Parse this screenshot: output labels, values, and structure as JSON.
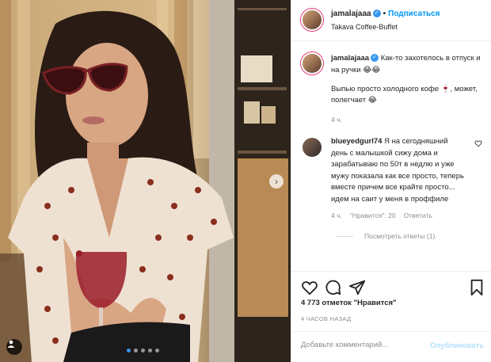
{
  "post": {
    "username": "jamalajaaa",
    "separator": "•",
    "follow_label": "Подписаться",
    "location": "Takava Coffee-Buffet"
  },
  "caption": {
    "username": "jamalajaaa",
    "line1": "Как-то захотелось в отпуск и на ручки 😂😂",
    "line2": "Выпью просто холодного кофе 🍷, может, полегчает 😂",
    "time": "4 ч."
  },
  "comment": {
    "username": "blueyedgurl74",
    "text": "Я на сегодняшний день с малышкой сижу дома и зарабатываю по 50т в недлю и уже мужу показала как все просто, теперь вместе причем все крайте просто... идем на саит у меня в проффиле",
    "time": "4 ч.",
    "likes": "\"Нравится\": 20",
    "reply_label": "Ответить",
    "view_replies": "Посмотреть ответы (1)"
  },
  "likes_text": "4 773 отметок \"Нравится\"",
  "timestamp": "4 ЧАСОВ НАЗАД",
  "comment_input": {
    "placeholder": "Добавьте комментарий...",
    "publish_label": "Опубликовать"
  },
  "icons": [
    "heart-icon",
    "comment-icon",
    "share-icon",
    "bookmark-icon",
    "verified-icon",
    "chevron-right-icon",
    "user-tag-icon"
  ],
  "colors": {
    "accent": "#0095f6",
    "verified": "#3897f0",
    "muted": "#8e8e8e",
    "border": "#efefef"
  }
}
